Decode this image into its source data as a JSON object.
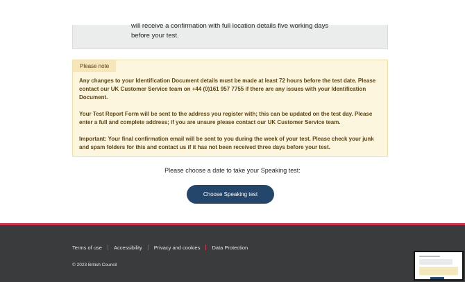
{
  "info": {
    "line1": "will receive a confirmation with full location details five working days",
    "line2": "before your test."
  },
  "note": {
    "title": "Please note",
    "para1": "Any changes to your Identification Document details must be made at least 72 hours before the test date. Please contact our UK Customer Service team on +44 (0)161 957 7755 if there are any issues with your Identification Document.",
    "para2": "Your Test Report Form will be sent to the address you register with; this can be updated on the test day. Please enter a full and complete address; if you are unsure please contact our UK Customer Service team.",
    "para3": "Important: Your final confirmation email will be sent to you during the week of your test. Please check your junk and spam folders for this and contact us if it has not been received three days before your test."
  },
  "prompt": "Please choose a date to take your Speaking test:",
  "cta_label": "Choose Speaking test",
  "footer": {
    "links": [
      "Terms of use",
      "Accessibility",
      "Privacy and cookies",
      "Data Protection"
    ],
    "copyright": "© 2023 British Council"
  },
  "colors": {
    "primary_button": "#23466a",
    "footer_bg": "#3a3b3d",
    "accent_red": "#d6304d",
    "note_bg": "#fdf6de"
  }
}
